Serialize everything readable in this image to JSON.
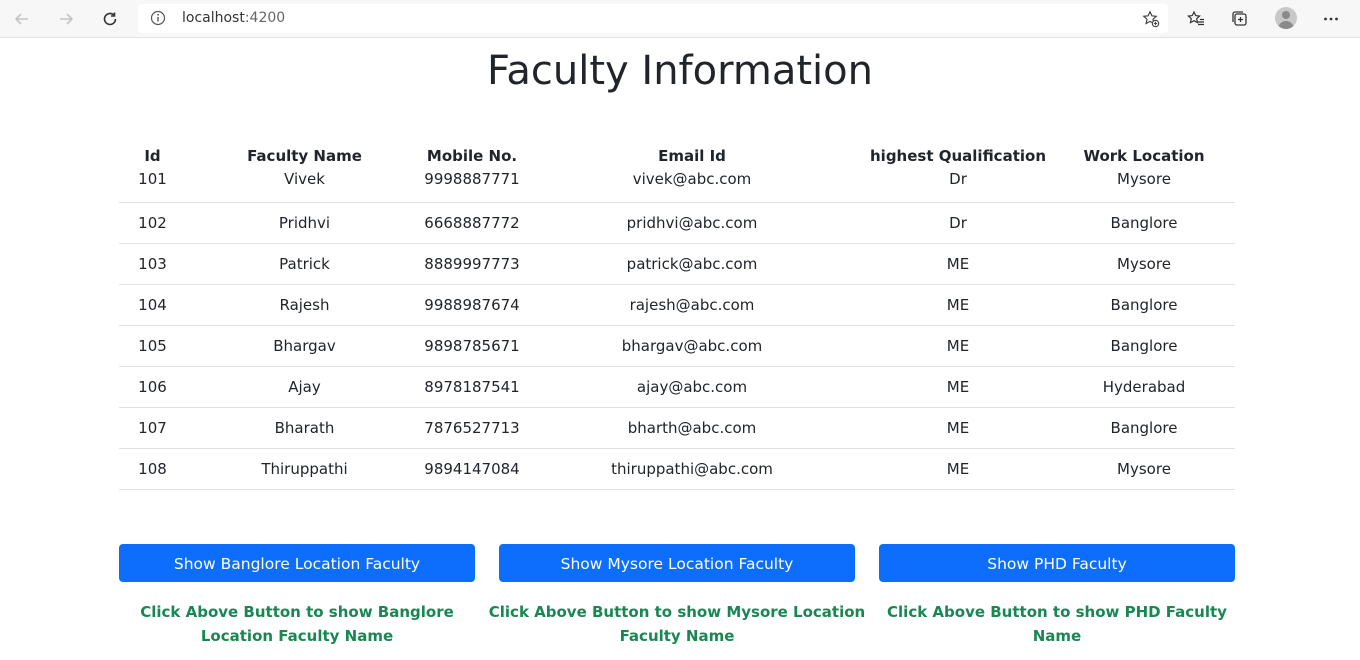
{
  "browser": {
    "url_host": "localhost",
    "url_port": ":4200"
  },
  "page": {
    "title": "Faculty Information"
  },
  "table": {
    "headers": [
      "Id",
      "Faculty Name",
      "Mobile No.",
      "Email Id",
      "highest Qualification",
      "Work Location"
    ],
    "rows": [
      [
        "101",
        "Vivek",
        "9998887771",
        "vivek@abc.com",
        "Dr",
        "Mysore"
      ],
      [
        "102",
        "Pridhvi",
        "6668887772",
        "pridhvi@abc.com",
        "Dr",
        "Banglore"
      ],
      [
        "103",
        "Patrick",
        "8889997773",
        "patrick@abc.com",
        "ME",
        "Mysore"
      ],
      [
        "104",
        "Rajesh",
        "9988987674",
        "rajesh@abc.com",
        "ME",
        "Banglore"
      ],
      [
        "105",
        "Bhargav",
        "9898785671",
        "bhargav@abc.com",
        "ME",
        "Banglore"
      ],
      [
        "106",
        "Ajay",
        "8978187541",
        "ajay@abc.com",
        "ME",
        "Hyderabad"
      ],
      [
        "107",
        "Bharath",
        "7876527713",
        "bharth@abc.com",
        "ME",
        "Banglore"
      ],
      [
        "108",
        "Thiruppathi",
        "9894147084",
        "thiruppathi@abc.com",
        "ME",
        "Mysore"
      ]
    ]
  },
  "buttons": {
    "banglore": "Show Banglore Location Faculty",
    "mysore": "Show Mysore Location Faculty",
    "phd": "Show PHD Faculty"
  },
  "notes": {
    "banglore": "Click Above Button to show Banglore Location Faculty Name",
    "mysore": "Click Above Button to show Mysore Location Faculty Name",
    "phd": "Click Above Button to show PHD Faculty Name"
  },
  "colors": {
    "button_bg": "#0d6efd",
    "note_text": "#198754"
  }
}
